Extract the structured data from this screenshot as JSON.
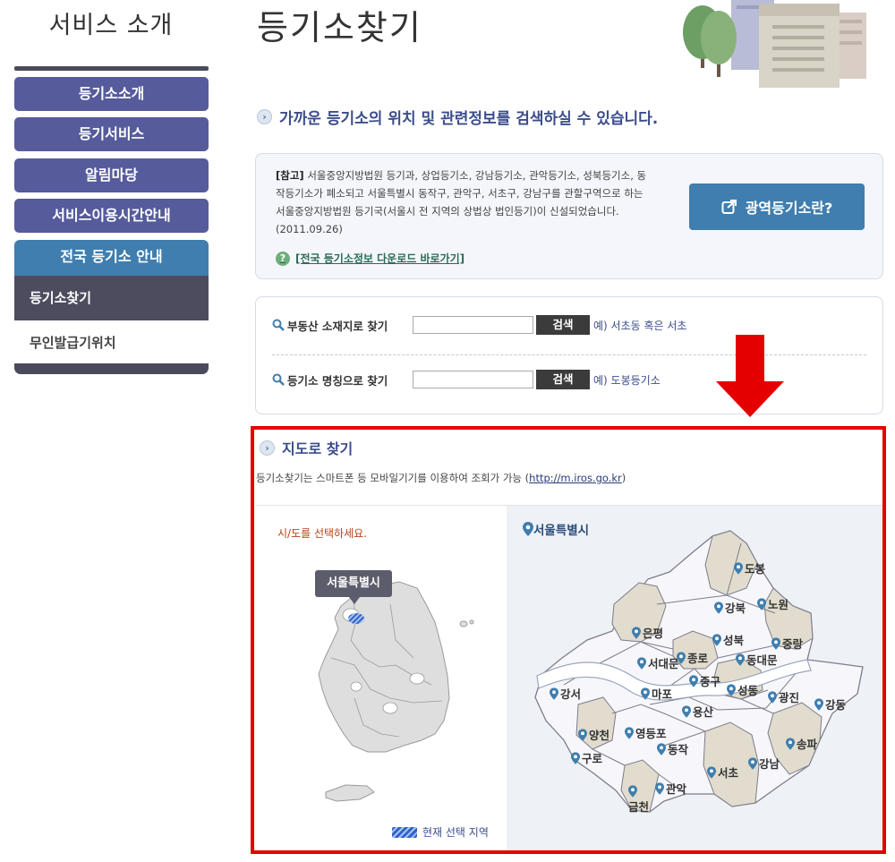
{
  "sidebar": {
    "title": "서비스 소개",
    "items": [
      {
        "label": "등기소소개"
      },
      {
        "label": "등기서비스"
      },
      {
        "label": "알림마당"
      },
      {
        "label": "서비스이용시간안내"
      },
      {
        "label": "전국 등기소 안내"
      }
    ],
    "subitems": [
      {
        "label": "등기소찾기"
      },
      {
        "label": "무인발급기위치"
      }
    ]
  },
  "header": {
    "title": "등기소찾기",
    "lead": "가까운 등기소의 위치 및 관련정보를 검색하실 수 있습니다."
  },
  "notice": {
    "tag": "[참고]",
    "text": " 서울중앙지방법원 등기과, 상업등기소, 강남등기소, 관악등기소, 성북등기소, 동작등기소가 폐소되고 서울특별시 동작구, 관악구, 서초구, 강남구를 관할구역으로 하는 서울중앙지방법원 등기국(서울시 전 지역의 상법상 법인등기)이 신설되었습니다. (2011.09.26)",
    "download_link": "[전국 등기소정보 다운로드 바로가기]",
    "wide_button": "광역등기소란?"
  },
  "search": {
    "row1": {
      "label": "부동산 소재지로 찾기",
      "value": "",
      "button": "검색",
      "hint": "예) 서초동 혹은 서초"
    },
    "row2": {
      "label": "등기소 명칭으로 찾기",
      "value": "",
      "button": "검색",
      "hint": "예) 도봉등기소"
    }
  },
  "map": {
    "heading": "지도로 찾기",
    "desc_prefix": "등기소찾기는 스마트폰 등 모바일기기를 이용하여 조회가 가능 (",
    "desc_link": "http://m.iros.go.kr",
    "desc_suffix": ")",
    "select_hint": "시/도를 선택하세요.",
    "selected_region": "서울특별시",
    "legend": "현재 선택 지역",
    "city_title": "서울특별시",
    "districts": [
      "도봉",
      "강북",
      "노원",
      "은평",
      "성북",
      "중랑",
      "종로",
      "서대문",
      "동대문",
      "중구",
      "강서",
      "마포",
      "성동",
      "광진",
      "강동",
      "용산",
      "영등포",
      "양천",
      "동작",
      "송파",
      "구로",
      "강남",
      "서초",
      "관악",
      "금천"
    ]
  },
  "colors": {
    "nav": "#565b9c",
    "active": "#3f7eae",
    "highlight_border": "#e50000",
    "arrow": "#e50000"
  }
}
